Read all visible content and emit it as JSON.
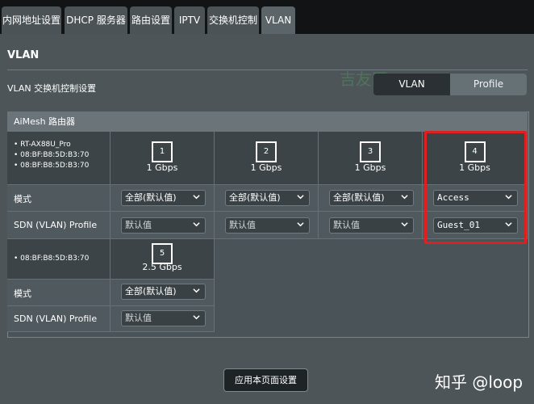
{
  "tabs": [
    "内网地址设置",
    "DHCP 服务器",
    "路由设置",
    "IPTV",
    "交换机控制",
    "VLAN"
  ],
  "page_title": "VLAN",
  "subtitle": "VLAN 交换机控制设置",
  "toggle": {
    "left": "VLAN",
    "right": "Profile"
  },
  "box_title": "AiMesh 路由器",
  "device1": {
    "lines": [
      "RT-AX88U_Pro",
      "08:BF:B8:5D:B3:70",
      "08:BF:B8:5D:B3:70"
    ]
  },
  "device2": {
    "lines": [
      "08:BF:B8:5D:B3:70"
    ]
  },
  "ports": [
    {
      "num": "1",
      "speed": "1 Gbps"
    },
    {
      "num": "2",
      "speed": "1 Gbps"
    },
    {
      "num": "3",
      "speed": "1 Gbps"
    },
    {
      "num": "4",
      "speed": "1 Gbps"
    },
    {
      "num": "5",
      "speed": "2.5 Gbps"
    }
  ],
  "row_labels": {
    "mode": "模式",
    "profile": "SDN (VLAN) Profile"
  },
  "modes": [
    "全部(默认值)",
    "全部(默认值)",
    "全部(默认值)",
    "Access",
    "全部(默认值)"
  ],
  "profiles": [
    "默认值",
    "默认值",
    "默认值",
    "Guest_01",
    "默认值"
  ],
  "apply_label": "应用本页面设置",
  "watermark": "知乎 @loop",
  "ghost": "吉友网",
  "accent": "#e02020"
}
